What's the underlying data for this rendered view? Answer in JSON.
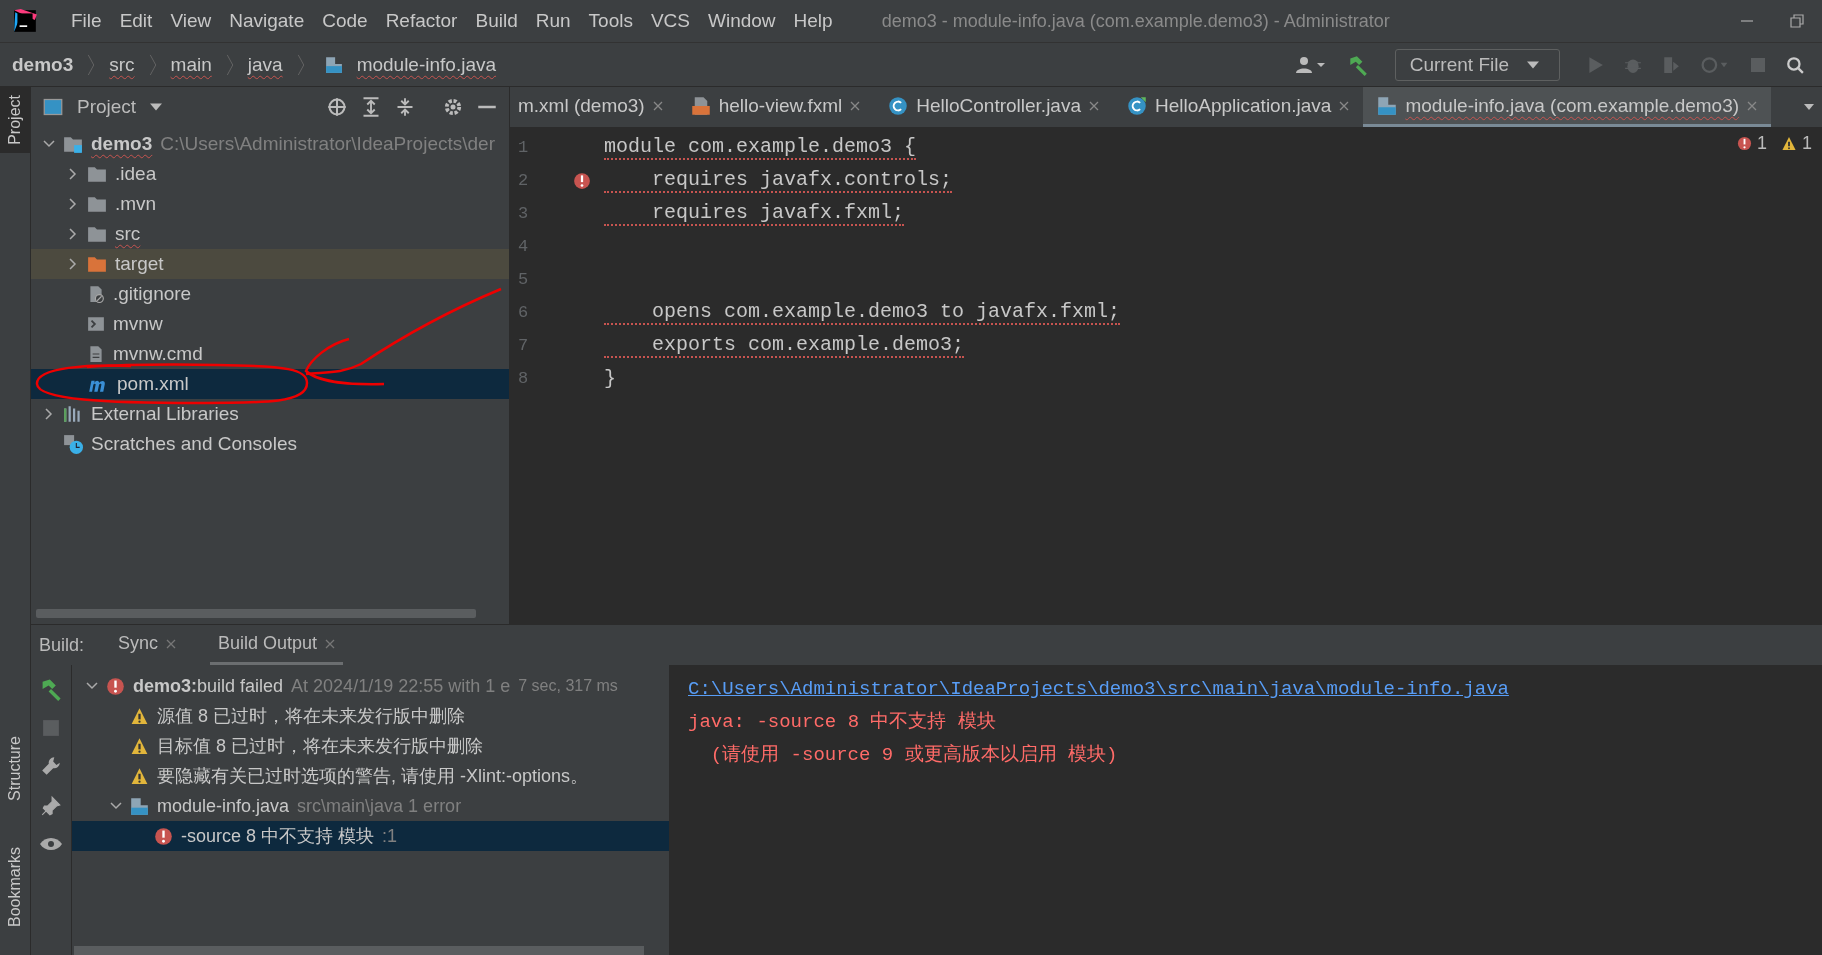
{
  "window": {
    "title": "demo3 - module-info.java (com.example.demo3) - Administrator"
  },
  "menu": [
    "File",
    "Edit",
    "View",
    "Navigate",
    "Code",
    "Refactor",
    "Build",
    "Run",
    "Tools",
    "VCS",
    "Window",
    "Help"
  ],
  "breadcrumbs": [
    {
      "label": "demo3",
      "kind": "project"
    },
    {
      "label": "src",
      "kind": "dir"
    },
    {
      "label": "main",
      "kind": "dir"
    },
    {
      "label": "java",
      "kind": "dir"
    },
    {
      "label": "module-info.java",
      "kind": "module"
    }
  ],
  "toolbar": {
    "run_config": "Current File"
  },
  "side_tabs": [
    {
      "label": "Project",
      "selected": true
    }
  ],
  "bottom_side_tabs": [
    {
      "label": "Structure",
      "selected": false
    },
    {
      "label": "Bookmarks",
      "selected": false
    }
  ],
  "project": {
    "title": "Project",
    "tree": [
      {
        "label": "demo3",
        "detail": "C:\\Users\\Administrator\\IdeaProjects\\der",
        "kind": "module",
        "expanded": true,
        "selected": false,
        "children": [
          {
            "label": ".idea",
            "kind": "folder",
            "expanded": false,
            "selected": false
          },
          {
            "label": ".mvn",
            "kind": "folder",
            "expanded": false,
            "selected": false
          },
          {
            "label": "src",
            "kind": "folder",
            "expanded": false,
            "selected": false
          },
          {
            "label": "target",
            "kind": "excluded",
            "expanded": false,
            "selected": false
          },
          {
            "label": ".gitignore",
            "kind": "ignore",
            "selected": false
          },
          {
            "label": "mvnw",
            "kind": "script",
            "selected": false
          },
          {
            "label": "mvnw.cmd",
            "kind": "file",
            "selected": false
          },
          {
            "label": "pom.xml",
            "kind": "maven",
            "selected": true
          }
        ]
      },
      {
        "label": "External Libraries",
        "kind": "libraries",
        "expanded": false,
        "selected": false
      },
      {
        "label": "Scratches and Consoles",
        "kind": "scratches",
        "selected": false
      }
    ]
  },
  "editor": {
    "tabs": [
      {
        "label": "m.xml (demo3)",
        "kind": "maven",
        "selected": false
      },
      {
        "label": "hello-view.fxml",
        "kind": "fxml",
        "selected": false
      },
      {
        "label": "HelloController.java",
        "kind": "class",
        "selected": false
      },
      {
        "label": "HelloApplication.java",
        "kind": "app",
        "selected": false
      },
      {
        "label": "module-info.java (com.example.demo3)",
        "kind": "module",
        "selected": true
      }
    ],
    "errors": "1",
    "warnings": "1",
    "lines": [
      {
        "number": "1",
        "text": "module com.example.demo3 {",
        "error": false,
        "underlined": true
      },
      {
        "number": "2",
        "text": "    requires javafx.controls;",
        "error": true,
        "underlined": true
      },
      {
        "number": "3",
        "text": "    requires javafx.fxml;",
        "error": false,
        "underlined": true
      },
      {
        "number": "4",
        "error": false,
        "underlined": false
      },
      {
        "number": "5",
        "error": false,
        "underlined": false
      },
      {
        "number": "6",
        "text": "    opens com.example.demo3 to javafx.fxml;",
        "error": false,
        "underlined": true
      },
      {
        "number": "7",
        "text": "    exports com.example.demo3;",
        "error": false,
        "underlined": true
      },
      {
        "number": "8",
        "text": "}",
        "error": false,
        "underlined": false
      }
    ]
  },
  "build": {
    "label": "Build:",
    "tabs": [
      {
        "label": "Sync",
        "selected": false
      },
      {
        "label": "Build Output",
        "selected": true
      }
    ],
    "tree": [
      {
        "kind": "error",
        "bold": "demo3:",
        "text": "build failed",
        "detail": "At 2024/1/19 22:55 with 1 e",
        "time": "7 sec, 317 ms",
        "expanded": true,
        "selected": false,
        "children": [
          {
            "kind": "warning",
            "text": "源值 8 已过时，将在未来发行版中删除",
            "selected": false
          },
          {
            "kind": "warning",
            "text": "目标值 8 已过时，将在未来发行版中删除",
            "selected": false
          },
          {
            "kind": "warning",
            "text": "要隐藏有关已过时选项的警告, 请使用 -Xlint:-options。",
            "selected": false
          },
          {
            "kind": "module",
            "text": "module-info.java",
            "detail": "src\\main\\java 1 error",
            "expanded": true,
            "selected": false,
            "children": [
              {
                "kind": "error",
                "text": "-source 8 中不支持 模块",
                "detail": ":1",
                "selected": true
              }
            ]
          }
        ]
      }
    ],
    "output": {
      "link": "C:\\Users\\Administrator\\IdeaProjects\\demo3\\src\\main\\java\\module-info.java",
      "lines": [
        "java: -source 8 中不支持 模块",
        "  (请使用 -source 9 或更高版本以启用 模块)"
      ]
    }
  }
}
